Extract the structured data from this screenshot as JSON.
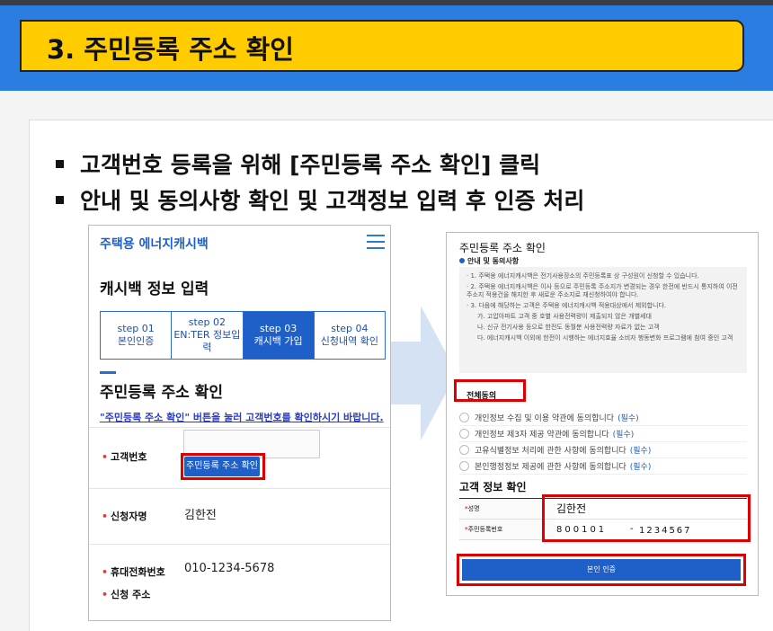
{
  "header": {
    "title": "3. 주민등록 주소 확인"
  },
  "bullets": [
    "고객번호 등록을 위해 [주민등록 주소 확인] 클릭",
    "안내 및 동의사항 확인 및 고객정보 입력 후 인증 처리"
  ],
  "left": {
    "brand": "주택용 에너지캐시백",
    "section1": "캐시백 정보 입력",
    "steps": [
      {
        "n": "step 01",
        "label": "본인인증"
      },
      {
        "n": "step 02",
        "label": "EN:TER 정보입력"
      },
      {
        "n": "step 03",
        "label": "캐시백 가입"
      },
      {
        "n": "step 04",
        "label": "신청내역 확인"
      }
    ],
    "section2": "주민등록 주소 확인",
    "notice": "\"주민등록 주소 확인\" 버튼을 눌러 고객번호를 확인하시기 바랍니다.",
    "fields": {
      "customer_no": "고객번호",
      "lookup_button": "주민등록 주소 확인",
      "applicant": "신청자명",
      "applicant_value": "김한전",
      "phone": "휴대전화번호",
      "phone_value": "010-1234-5678",
      "address": "신청 주소"
    }
  },
  "right": {
    "title": "주민등록 주소 확인",
    "sub": "안내 및 동의사항",
    "notice_lines": [
      "· 1. 주택용 에너지캐시백은 전기사용장소의 주민등록표 상 구성원이 신청할 수 있습니다.",
      "· 2. 주택용 에너지캐시백은 이사 등으로 주민등록 주소지가 변경되는 경우 한전에 반드시 통지하여 이전 주소지 적용건을 해지한 후 새로운 주소지로 재신청하여야 합니다.",
      "· 3. 다음에 해당하는 고객은 주택용 에너지캐시백 적용대상에서 제외합니다.",
      "가. 고압아파트 고객 중 호별 사용전력량이 제출되지 않은 개별세대",
      "나. 신규 전기사용 등으로 한전도 동월분 사용전력량 자료가 없는 고객",
      "다. 에너지캐시백 이외에 한전이 시행하는 에너지효율 소비자 행동변화 프로그램에 참여 중인 고객"
    ],
    "agree_all": "전체동의",
    "agrees": [
      "개인정보 수집 및 이용 약관에 동의합니다",
      "개인정보 제3자 제공 약관에 동의합니다",
      "고유식별정보 처리에 관한 사항에 동의합니다",
      "본인행정정보 제공에 관한 사항에 동의합니다"
    ],
    "required": "(필수)",
    "customer_section": "고객 정보 확인",
    "name_label": "성명",
    "name_value": "김한전",
    "rrn_label": "주민등록번호",
    "rrn_front": "800101",
    "rrn_back": "1234567",
    "rrn_dash": "-",
    "auth_button": "본인 인증"
  }
}
